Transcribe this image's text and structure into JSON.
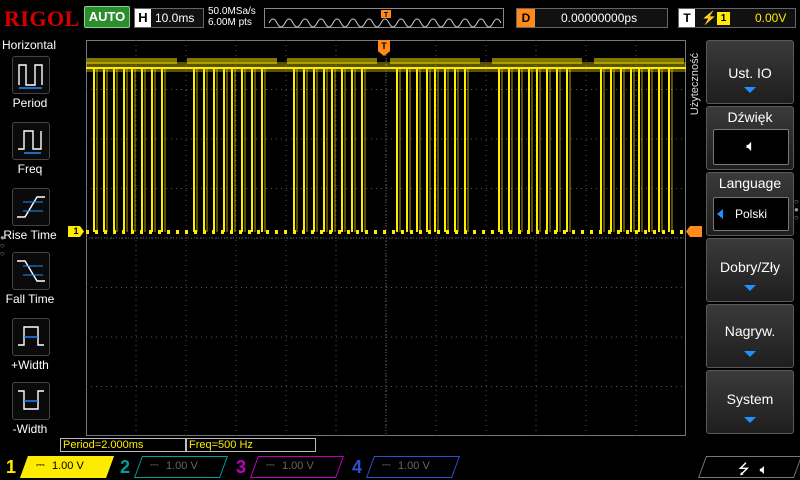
{
  "header": {
    "brand": "RIGOL",
    "run_state": "AUTO",
    "horizontal": {
      "letter": "H",
      "timebase": "10.0ms"
    },
    "sample_rate": "50.0MSa/s",
    "memory_depth": "6.00M pts",
    "trigger_marker": "T",
    "delay": {
      "letter": "D",
      "value": "0.00000000ps"
    },
    "trigger": {
      "letter": "T",
      "source_channel": "1",
      "level": "0.00V",
      "edge_icon": "rising-edge-icon"
    }
  },
  "left_menu": {
    "title": "Horizontal",
    "items": [
      {
        "label": "Period",
        "icon": "period-icon"
      },
      {
        "label": "Freq",
        "icon": "frequency-icon"
      },
      {
        "label": "Rise Time",
        "icon": "rise-time-icon"
      },
      {
        "label": "Fall Time",
        "icon": "fall-time-icon"
      },
      {
        "label": "+Width",
        "icon": "positive-width-icon"
      },
      {
        "label": "-Width",
        "icon": "negative-width-icon"
      }
    ]
  },
  "markers": {
    "ch1": "1",
    "trigger_top": "T"
  },
  "measurements": {
    "period": "Period=2.000ms",
    "freq": "Freq=500 Hz"
  },
  "right_menu": {
    "title": "Użyteczność",
    "buttons": [
      {
        "label": "Ust. IO"
      },
      {
        "label": "Dźwięk",
        "icon": "speaker-icon"
      },
      {
        "label": "Language",
        "value": "Polski"
      },
      {
        "label": "Dobry/Zły"
      },
      {
        "label": "Nagryw."
      },
      {
        "label": "System"
      }
    ]
  },
  "channels": [
    {
      "number": "1",
      "scale": "1.00 V",
      "active": true
    },
    {
      "number": "2",
      "scale": "1.00 V",
      "active": false
    },
    {
      "number": "3",
      "scale": "1.00 V",
      "active": false
    },
    {
      "number": "4",
      "scale": "1.00 V",
      "active": false
    }
  ],
  "status_icons": [
    "usb-icon",
    "speaker-icon"
  ],
  "colors": {
    "ch1": "#ffeb00",
    "ch2": "#00a0a0",
    "ch3": "#c000c0",
    "ch4": "#3050d0",
    "trigger": "#ff8a1a",
    "brand": "#d40000",
    "run_state": "#2e8b2e",
    "menu_arrow": "#1e90ff"
  }
}
